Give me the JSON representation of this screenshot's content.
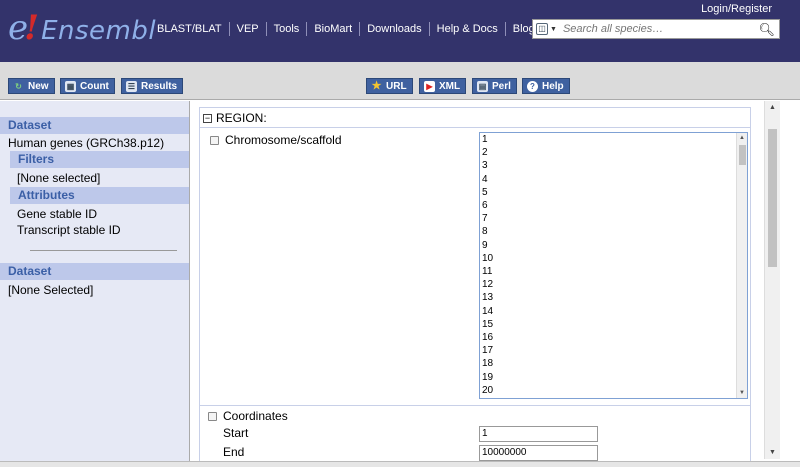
{
  "header": {
    "logo_e": "e",
    "logo_bang": "!",
    "logo_word": "Ensembl",
    "nav": [
      "BLAST/BLAT",
      "VEP",
      "Tools",
      "BioMart",
      "Downloads",
      "Help & Docs",
      "Blog"
    ],
    "login": "Login/Register",
    "search_placeholder": "Search all species…"
  },
  "toolbar": {
    "new": "New",
    "count": "Count",
    "results": "Results",
    "url": "URL",
    "xml": "XML",
    "perl": "Perl",
    "help": "Help"
  },
  "left": {
    "dataset_header": "Dataset",
    "dataset_value": "Human genes (GRCh38.p12)",
    "filters_header": "Filters",
    "filters_value": "[None selected]",
    "attributes_header": "Attributes",
    "attributes": [
      "Gene stable ID",
      "Transcript stable ID"
    ],
    "dataset2_header": "Dataset",
    "dataset2_value": "[None Selected]"
  },
  "region": {
    "title": "REGION:",
    "chromosome_label": "Chromosome/scaffold",
    "chromosomes": [
      "1",
      "2",
      "3",
      "4",
      "5",
      "6",
      "7",
      "8",
      "9",
      "10",
      "11",
      "12",
      "13",
      "14",
      "15",
      "16",
      "17",
      "18",
      "19",
      "20"
    ],
    "coordinates_label": "Coordinates",
    "start_label": "Start",
    "start_value": "1",
    "end_label": "End",
    "end_value": "10000000"
  },
  "colors": {
    "header_bg": "#33336b",
    "button_bg": "#3f61a0",
    "panel_header_bg": "#bdc8ea",
    "panel_header_text": "#3b5fa6"
  }
}
